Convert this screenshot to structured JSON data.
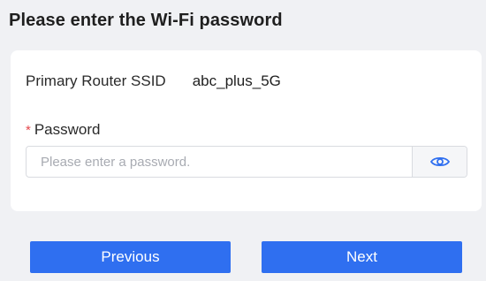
{
  "header": {
    "title": "Please enter the Wi-Fi password"
  },
  "form": {
    "ssid_label": "Primary Router SSID",
    "ssid_value": "abc_plus_5G",
    "password_required_marker": "*",
    "password_label": "Password",
    "password_value": "",
    "password_placeholder": "Please enter a password.",
    "visibility_icon": "eye-icon"
  },
  "actions": {
    "previous_label": "Previous",
    "next_label": "Next"
  },
  "colors": {
    "primary": "#2f6ff0",
    "required": "#e5484d",
    "background": "#f0f1f4"
  }
}
